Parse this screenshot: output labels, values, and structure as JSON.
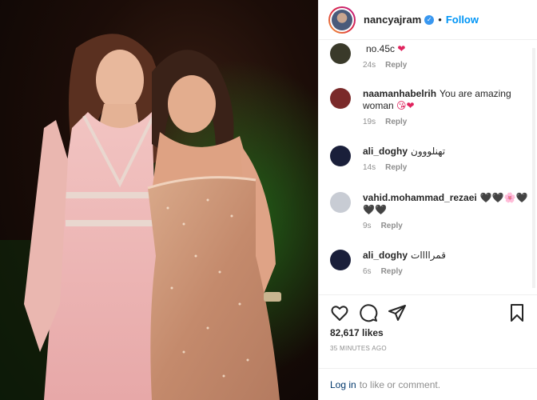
{
  "post": {
    "author": {
      "username": "nancyajram",
      "follow_label": "Follow",
      "separator": "•"
    },
    "comments": [
      {
        "username": "",
        "text": "no.45c",
        "emoji": "❤",
        "time": "24s",
        "reply_label": "Reply",
        "avatar_color": "#3a3a2a"
      },
      {
        "username": "naamanhabelrih",
        "text": "You are amazing woman",
        "emoji": "😘❤",
        "time": "19s",
        "reply_label": "Reply",
        "avatar_color": "#7a2a2a"
      },
      {
        "username": "ali_doghy",
        "text": "تهنلووون",
        "emoji": "",
        "time": "14s",
        "reply_label": "Reply",
        "avatar_color": "#1a1f3a"
      },
      {
        "username": "vahid.mohammad_rezaei",
        "text": "",
        "emoji": "🖤🖤🌸🖤🖤🖤",
        "time": "9s",
        "reply_label": "Reply",
        "avatar_color": "#c8ccd4"
      },
      {
        "username": "ali_doghy",
        "text": "قمراااات",
        "emoji": "",
        "time": "6s",
        "reply_label": "Reply",
        "avatar_color": "#1a1f3a"
      }
    ],
    "likes": "82,617 likes",
    "posted_time": "35 MINUTES AGO",
    "login_link": "Log in",
    "login_suffix": "to like or comment."
  }
}
